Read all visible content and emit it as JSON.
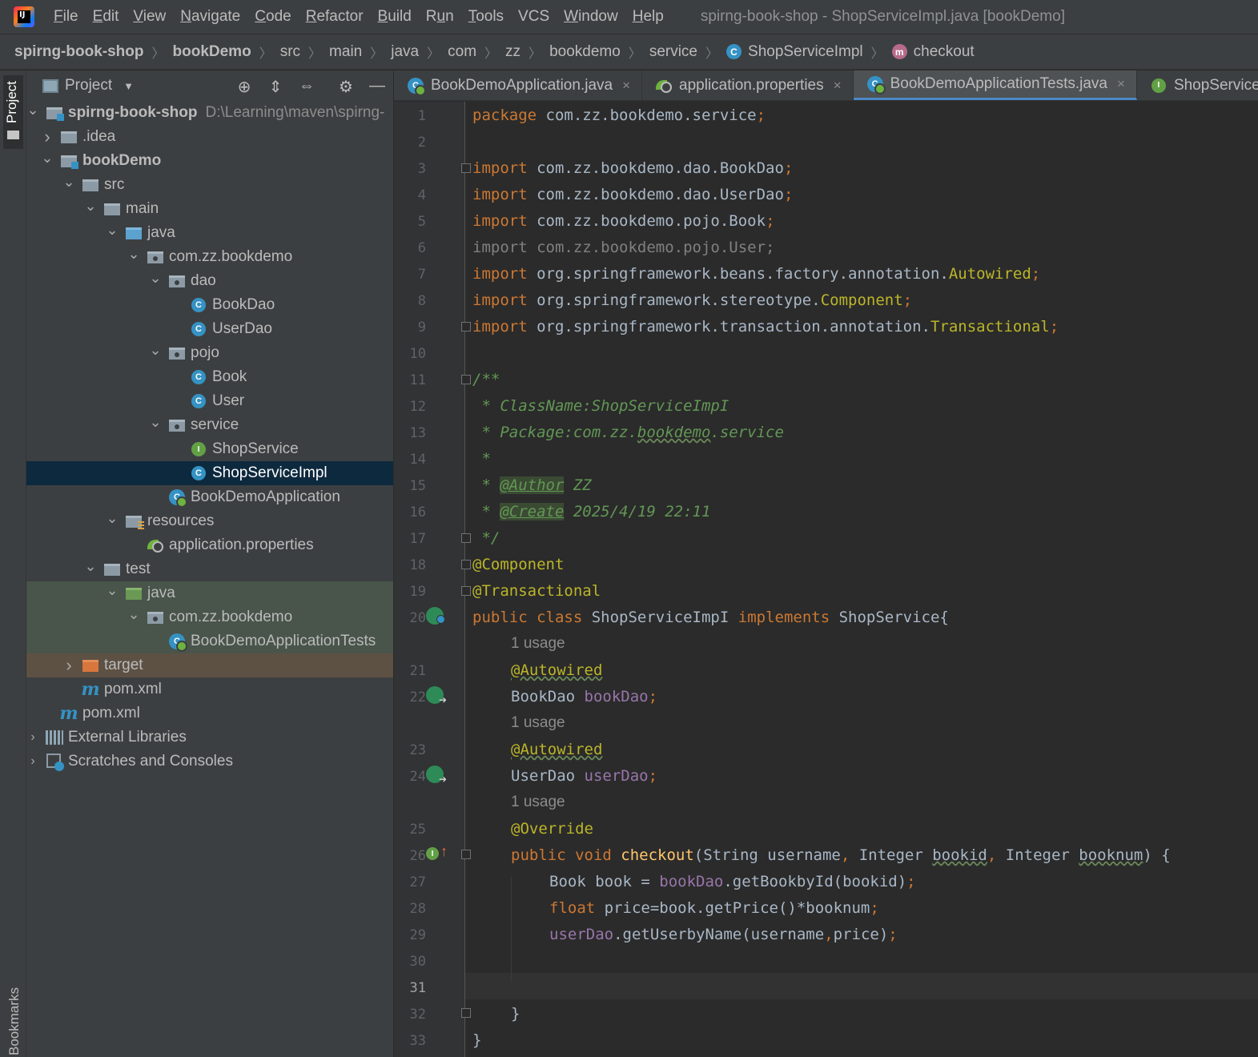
{
  "menu": {
    "items": [
      "File",
      "Edit",
      "View",
      "Navigate",
      "Code",
      "Refactor",
      "Build",
      "Run",
      "Tools",
      "VCS",
      "Window",
      "Help"
    ],
    "mnemonics": [
      "F",
      "E",
      "V",
      "N",
      "C",
      "R",
      "B",
      "u",
      "T",
      "",
      "W",
      "H"
    ],
    "window_title": "spirng-book-shop - ShopServiceImpl.java [bookDemo]",
    "logo_text": "IJ"
  },
  "breadcrumb": {
    "items": [
      "spirng-book-shop",
      "bookDemo",
      "src",
      "main",
      "java",
      "com",
      "zz",
      "bookdemo",
      "service",
      "ShopServiceImpl",
      "checkout"
    ],
    "class_icon": "C",
    "method_icon": "m"
  },
  "left_strip": {
    "project_label": "Project",
    "bookmarks_label": "Bookmarks"
  },
  "project_panel": {
    "title": "Project",
    "header_icons": [
      "locate-icon",
      "expand-all-icon",
      "collapse-all-icon",
      "settings-icon",
      "hide-icon"
    ],
    "tree": [
      {
        "label": "spirng-book-shop",
        "path": "D:\\Learning\\maven\\spirng-",
        "icon": "folder-module",
        "arrow": "down",
        "level": 0,
        "bold": true
      },
      {
        "label": ".idea",
        "icon": "folder",
        "arrow": "right",
        "level": 1
      },
      {
        "label": "bookDemo",
        "icon": "folder-module",
        "arrow": "down",
        "level": 1,
        "bold": true
      },
      {
        "label": "src",
        "icon": "folder",
        "arrow": "down",
        "level": 2
      },
      {
        "label": "main",
        "icon": "folder",
        "arrow": "down",
        "level": 3
      },
      {
        "label": "java",
        "icon": "folder-blue",
        "arrow": "down",
        "level": 4
      },
      {
        "label": "com.zz.bookdemo",
        "icon": "package",
        "arrow": "down",
        "level": 5
      },
      {
        "label": "dao",
        "icon": "package",
        "arrow": "down",
        "level": 6
      },
      {
        "label": "BookDao",
        "icon": "class",
        "arrow": "",
        "level": 7
      },
      {
        "label": "UserDao",
        "icon": "class",
        "arrow": "",
        "level": 7
      },
      {
        "label": "pojo",
        "icon": "package",
        "arrow": "down",
        "level": 6
      },
      {
        "label": "Book",
        "icon": "class",
        "arrow": "",
        "level": 7
      },
      {
        "label": "User",
        "icon": "class",
        "arrow": "",
        "level": 7
      },
      {
        "label": "service",
        "icon": "package",
        "arrow": "down",
        "level": 6
      },
      {
        "label": "ShopService",
        "icon": "interface",
        "arrow": "",
        "level": 7
      },
      {
        "label": "ShopServiceImpl",
        "icon": "class",
        "arrow": "",
        "level": 7,
        "selected": true
      },
      {
        "label": "BookDemoApplication",
        "icon": "spring",
        "arrow": "",
        "level": 6
      },
      {
        "label": "resources",
        "icon": "resources",
        "arrow": "down",
        "level": 4
      },
      {
        "label": "application.properties",
        "icon": "props",
        "arrow": "",
        "level": 5
      },
      {
        "label": "test",
        "icon": "folder",
        "arrow": "down",
        "level": 3
      },
      {
        "label": "java",
        "icon": "folder-green",
        "arrow": "down",
        "level": 4,
        "highlight": "test"
      },
      {
        "label": "com.zz.bookdemo",
        "icon": "package",
        "arrow": "down",
        "level": 5,
        "highlight": "test"
      },
      {
        "label": "BookDemoApplicationTests",
        "icon": "spring",
        "arrow": "",
        "level": 6,
        "highlight": "test"
      },
      {
        "label": "target",
        "icon": "folder-orange",
        "arrow": "right",
        "level": 2,
        "highlight": "excluded"
      },
      {
        "label": "pom.xml",
        "icon": "maven",
        "arrow": "",
        "level": 2
      },
      {
        "label": "pom.xml",
        "icon": "maven",
        "arrow": "",
        "level": 1
      },
      {
        "label": "External Libraries",
        "icon": "libs",
        "arrow": "right-small",
        "level": 0
      },
      {
        "label": "Scratches and Consoles",
        "icon": "scratch",
        "arrow": "right-small",
        "level": 0
      }
    ]
  },
  "editor_tabs": [
    {
      "label": "BookDemoApplication.java",
      "icon": "spring",
      "close": "×"
    },
    {
      "label": "application.properties",
      "icon": "props",
      "close": "×"
    },
    {
      "label": "BookDemoApplicationTests.java",
      "icon": "spring",
      "close": "×",
      "active": true
    },
    {
      "label": "ShopService.",
      "icon": "interface",
      "close": ""
    }
  ],
  "editor": {
    "current_line": 31,
    "line_numbers": [
      "1",
      "2",
      "3",
      "4",
      "5",
      "6",
      "7",
      "8",
      "9",
      "10",
      "11",
      "12",
      "13",
      "14",
      "15",
      "16",
      "17",
      "18",
      "19",
      "20",
      "21",
      "22",
      "23",
      "24",
      "25",
      "26",
      "27",
      "28",
      "29",
      "30",
      "31",
      "32",
      "33"
    ],
    "inlay_hint": "1 usage",
    "code": {
      "l1": [
        "package",
        " com.zz.bookdemo.service",
        ";"
      ],
      "l3": [
        "import",
        " com.zz.bookdemo.dao.BookDao",
        ";"
      ],
      "l4": [
        "import",
        " com.zz.bookdemo.dao.UserDao",
        ";"
      ],
      "l5": [
        "import",
        " com.zz.bookdemo.pojo.Book",
        ";"
      ],
      "l6": "import com.zz.bookdemo.pojo.User;",
      "l7": [
        "import",
        " org.springframework.beans.factory.annotation.",
        "Autowired",
        ";"
      ],
      "l8": [
        "import",
        " org.springframework.stereotype.",
        "Component",
        ";"
      ],
      "l9": [
        "import",
        " org.springframework.transaction.annotation.",
        "Transactional",
        ";"
      ],
      "l11": "/**",
      "l12": " * ClassName:ShopServiceImpI",
      "l13": [
        " * Package:com.zz.",
        "bookdemo",
        ".service"
      ],
      "l14": " *",
      "l15": [
        " * ",
        "@Author",
        " ZZ"
      ],
      "l16": [
        " * ",
        "@Create",
        " 2025/4/19 22:11"
      ],
      "l17": " */",
      "l18": "@Component",
      "l19": "@Transactional",
      "l20": [
        "public class",
        " ShopServiceImpI ",
        "implements",
        " ShopService{"
      ],
      "l21": "@Autowired",
      "l22": [
        "BookDao ",
        "bookDao",
        ";"
      ],
      "l23": "@Autowired",
      "l24": [
        "UserDao ",
        "userDao",
        ";"
      ],
      "l25": "@Override",
      "l26": [
        "public void ",
        "checkout",
        "(String username",
        ", ",
        "Integer ",
        "bookid",
        ", ",
        "Integer ",
        "booknum",
        ") {"
      ],
      "l27": [
        "Book book = ",
        "bookDao",
        ".getBookbyId(bookid)",
        ";"
      ],
      "l28": [
        "float",
        " price=book.getPrice()*booknum",
        ";"
      ],
      "l29": [
        "userDao",
        ".getUserbyName(username",
        ",",
        "price)",
        ";"
      ],
      "l32": "}",
      "l33": "}"
    }
  }
}
